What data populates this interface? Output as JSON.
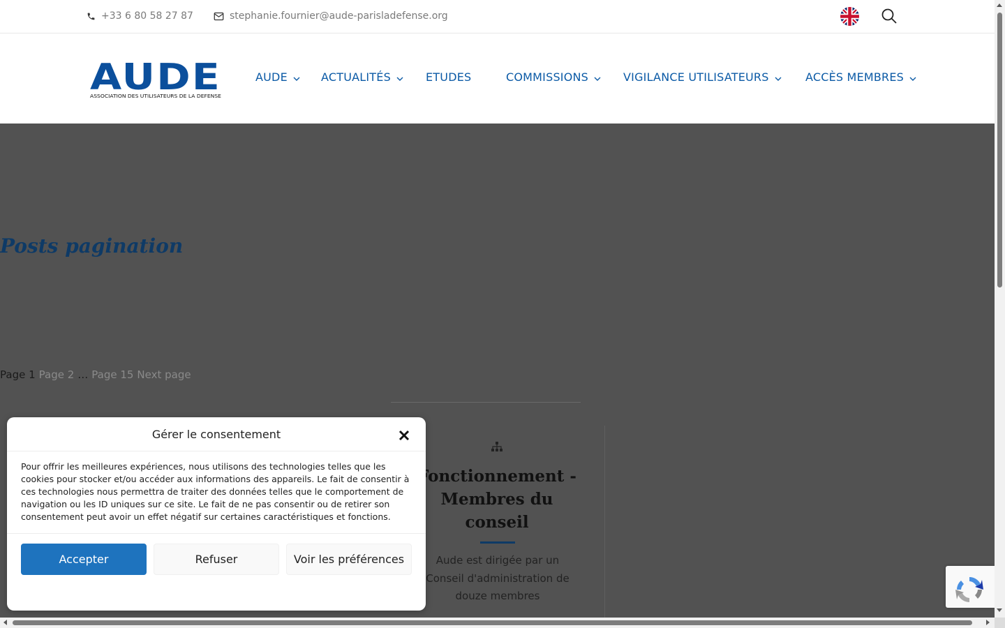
{
  "topbar": {
    "phone": "+33 6 80 58 27 87",
    "email": "stephanie.fournier@aude-parisladefense.org"
  },
  "logo": {
    "letters": "AUDE",
    "tagline": "ASSOCIATION DES UTILISATEURS DE LA DEFENSE"
  },
  "nav": {
    "items": [
      {
        "label": "AUDE",
        "has_dropdown": true
      },
      {
        "label": "ACTUALITÉS",
        "has_dropdown": true
      },
      {
        "label": "ETUDES",
        "has_dropdown": false
      },
      {
        "label": "COMMISSIONS",
        "has_dropdown": true
      },
      {
        "label": "VIGILANCE UTILISATEURS",
        "has_dropdown": true
      },
      {
        "label": "ACCÈS MEMBRES",
        "has_dropdown": true
      }
    ]
  },
  "main": {
    "heading": "Posts pagination",
    "pagination": {
      "current": "Page 1",
      "page2": "Page 2",
      "ellipsis": "…",
      "last": "Page 15",
      "next": "Next page"
    }
  },
  "card": {
    "icon": "sitemap-icon",
    "title": "Fonctionnement - Membres du conseil",
    "text": "Aude est dirigée par un Conseil d'administration de douze membres"
  },
  "cookie": {
    "title": "Gérer le consentement",
    "body": "Pour offrir les meilleures expériences, nous utilisons des technologies telles que les cookies pour stocker et/ou accéder aux informations des appareils. Le fait de consentir à ces technologies nous permettra de traiter des données telles que le comportement de navigation ou les ID uniques sur ce site. Le fait de ne pas consentir ou de retirer son consentement peut avoir un effet négatif sur certaines caractéristiques et fonctions.",
    "accept": "Accepter",
    "deny": "Refuser",
    "prefs": "Voir les préférences"
  },
  "colors": {
    "brand_blue": "#0b5aa6",
    "accept_blue": "#1e73be",
    "heading_navy": "#0e3a66"
  }
}
